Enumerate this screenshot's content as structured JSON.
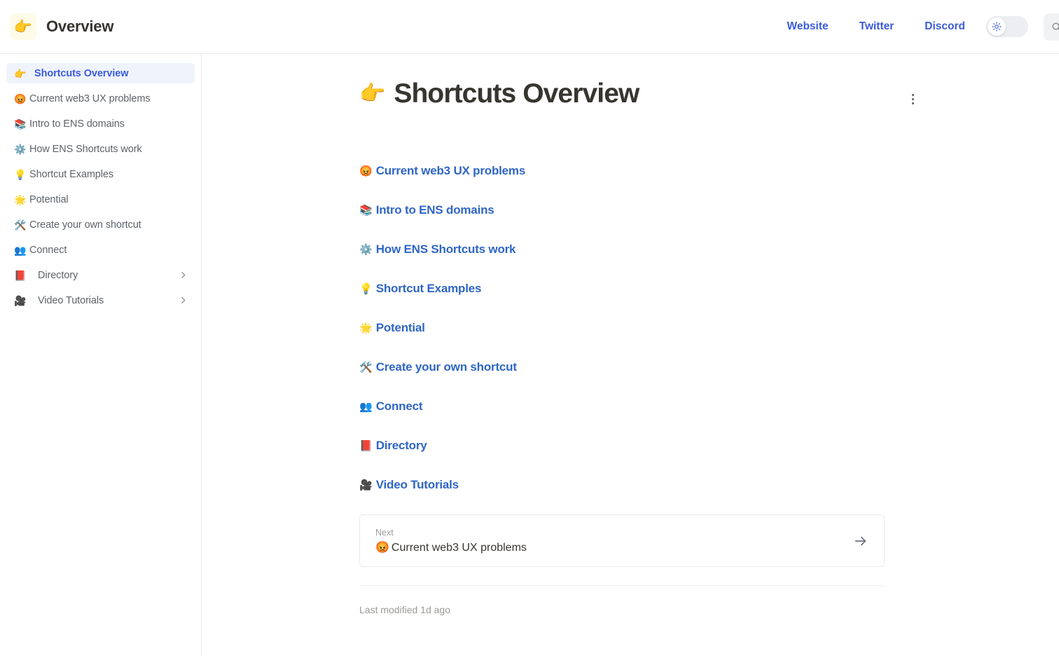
{
  "header": {
    "brand_emoji": "👉",
    "brand_title": "Overview",
    "nav_links": [
      {
        "label": "Website"
      },
      {
        "label": "Twitter"
      },
      {
        "label": "Discord"
      }
    ],
    "theme_toggle": {
      "icon": "sun-icon",
      "state": "light"
    },
    "search": {
      "placeholder": "Search",
      "value": ""
    }
  },
  "sidebar": {
    "items": [
      {
        "emoji": "👉",
        "label": "Shortcuts Overview",
        "active": true,
        "nested": false,
        "expandable": false
      },
      {
        "emoji": "😡",
        "label": "Current web3 UX problems",
        "active": false,
        "nested": false,
        "expandable": false
      },
      {
        "emoji": "📚",
        "label": "Intro to ENS domains",
        "active": false,
        "nested": false,
        "expandable": false
      },
      {
        "emoji": "⚙️",
        "label": "How ENS Shortcuts work",
        "active": false,
        "nested": false,
        "expandable": false
      },
      {
        "emoji": "💡",
        "label": "Shortcut Examples",
        "active": false,
        "nested": false,
        "expandable": false
      },
      {
        "emoji": "🌟",
        "label": "Potential",
        "active": false,
        "nested": false,
        "expandable": false
      },
      {
        "emoji": "🛠️",
        "label": "Create your own shortcut",
        "active": false,
        "nested": false,
        "expandable": false
      },
      {
        "emoji": "👥",
        "label": "Connect",
        "active": false,
        "nested": false,
        "expandable": false
      },
      {
        "emoji": "📕",
        "label": "Directory",
        "active": false,
        "nested": true,
        "expandable": true
      },
      {
        "emoji": "🎥",
        "label": "Video Tutorials",
        "active": false,
        "nested": true,
        "expandable": true
      }
    ]
  },
  "main": {
    "page_emoji": "👉",
    "page_title": "Shortcuts Overview",
    "kebab_menu_label": "more-options",
    "links": [
      {
        "emoji": "😡",
        "label": "Current web3 UX problems"
      },
      {
        "emoji": "📚",
        "label": "Intro to ENS domains"
      },
      {
        "emoji": "⚙️",
        "label": "How ENS Shortcuts work"
      },
      {
        "emoji": "💡",
        "label": "Shortcut Examples"
      },
      {
        "emoji": "🌟",
        "label": "Potential"
      },
      {
        "emoji": "🛠️",
        "label": "Create your own shortcut"
      },
      {
        "emoji": "👥",
        "label": "Connect"
      },
      {
        "emoji": "📕",
        "label": "Directory"
      },
      {
        "emoji": "🎥",
        "label": "Video Tutorials"
      }
    ],
    "next_card": {
      "label": "Next",
      "emoji": "😡",
      "title": "Current web3 UX problems",
      "arrow": "arrow-right-icon"
    },
    "last_modified": "Last modified 1d ago"
  },
  "colors": {
    "accent_blue": "#3b5bdb",
    "link_blue": "#2f66c4",
    "active_bg": "#eff3fc",
    "text_dark": "#37352f",
    "text_muted": "#9b9a97",
    "border": "#ebebeb"
  }
}
